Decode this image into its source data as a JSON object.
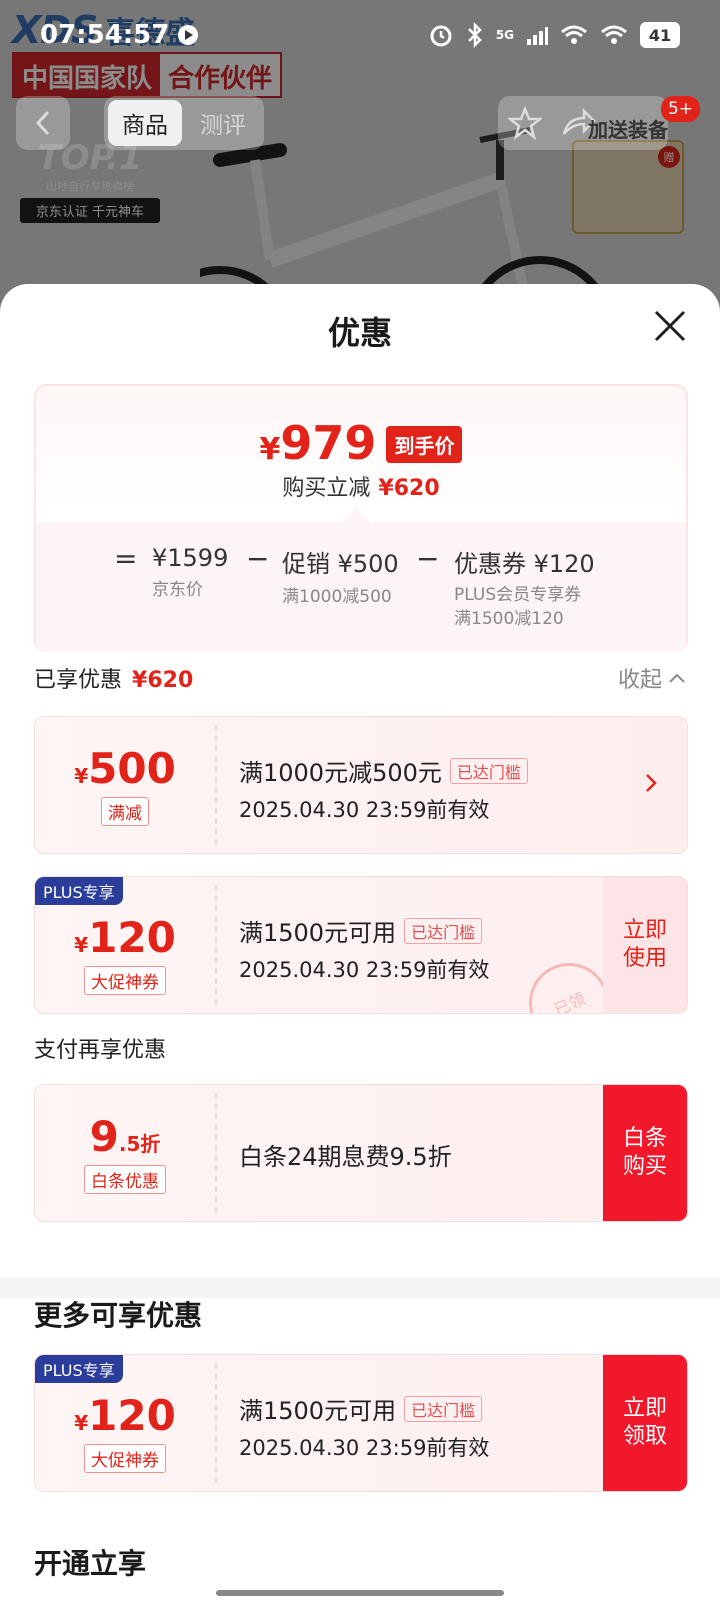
{
  "status_bar": {
    "time": "07:54:57",
    "network": "5G",
    "battery": "41"
  },
  "background": {
    "brand_logo": "XDS",
    "brand_cn": "喜德盛",
    "team_banner_a": "中国国家队",
    "team_banner_b": "合作伙伴",
    "top_badge": "TOP.1",
    "top_badge_sub": "山地自行车热卖榜",
    "top_badge_cert": "京东认证 千元神车",
    "gift_text": "加送装备",
    "gift_tag": "赠",
    "badge_count": "5+"
  },
  "nav": {
    "tabs": [
      {
        "label": "商品"
      },
      {
        "label": "测评"
      }
    ]
  },
  "sheet": {
    "title": "优惠",
    "summary": {
      "yen": "¥",
      "final_price": "979",
      "final_tag": "到手价",
      "save_label": "购买立减",
      "save_amount": "¥620",
      "equals": "=",
      "minus": "−",
      "base_price": "¥1599",
      "base_label": "京东价",
      "promo_value": "促销 ¥500",
      "promo_label": "满1000减500",
      "coupon_value": "优惠券 ¥120",
      "coupon_label1": "PLUS会员专享券",
      "coupon_label2": "满1500减120"
    },
    "enjoyed": {
      "label": "已享优惠",
      "amount": "¥620",
      "collapse": "收起"
    },
    "coupons": [
      {
        "yen": "¥",
        "amount": "500",
        "label": "满减",
        "title": "满1000元减500元",
        "status": "已达门槛",
        "date": "2025.04.30 23:59前有效"
      },
      {
        "plus_tag": "PLUS专享",
        "yen": "¥",
        "amount": "120",
        "label": "大促神券",
        "title": "满1500元可用",
        "status": "已达门槛",
        "date": "2025.04.30 23:59前有效",
        "action": "立即使用",
        "stamp": "已领"
      }
    ],
    "payment": {
      "heading": "支付再享优惠",
      "amount_big": "9",
      "amount_small": ".5折",
      "label": "白条优惠",
      "title": "白条24期息费9.5折",
      "action": "白条购买"
    },
    "more": {
      "heading": "更多可享优惠",
      "coupon": {
        "plus_tag": "PLUS专享",
        "yen": "¥",
        "amount": "120",
        "label": "大促神券",
        "title": "满1500元可用",
        "status": "已达门槛",
        "date": "2025.04.30 23:59前有效",
        "action": "立即领取"
      }
    },
    "bottom_heading": "开通立享"
  },
  "colors": {
    "accent": "#e2231a",
    "plus": "#2b3d9a"
  }
}
